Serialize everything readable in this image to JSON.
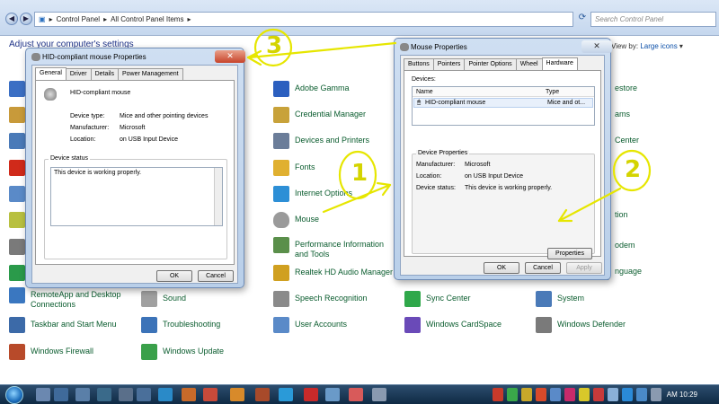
{
  "explorer": {
    "breadcrumb": [
      "Control Panel",
      "All Control Panel Items"
    ],
    "search_placeholder": "Search Control Panel",
    "header": "Adjust your computer's settings",
    "view_by_label": "View by:",
    "view_by_value": "Large icons"
  },
  "cp_items": [
    {
      "label": "Adobe Gamma",
      "color": "#2b5fbf"
    },
    {
      "label": "Credential Manager",
      "color": "#c8a23a"
    },
    {
      "label": "Devices and Printers",
      "color": "#6b7d99"
    },
    {
      "label": "Fonts",
      "color": "#e0b030"
    },
    {
      "label": "Internet Options",
      "color": "#2d8fd6"
    },
    {
      "label": "Mouse",
      "color": "#9a9a9a"
    },
    {
      "label": "Performance Information and Tools",
      "color": "#5a8f4a"
    },
    {
      "label": "Realtek HD Audio Manager",
      "color": "#d0a020"
    },
    {
      "label": "RemoteApp and Desktop Connections",
      "color": "#3a77c0"
    },
    {
      "label": "Sound",
      "color": "#a0a0a0"
    },
    {
      "label": "Speech Recognition",
      "color": "#8a8a8a"
    },
    {
      "label": "Sync Center",
      "color": "#2fa84a"
    },
    {
      "label": "System",
      "color": "#4a7ab8"
    },
    {
      "label": "Taskbar and Start Menu",
      "color": "#3c6aa8"
    },
    {
      "label": "Troubleshooting",
      "color": "#3c73b8"
    },
    {
      "label": "User Accounts",
      "color": "#5a8ac8"
    },
    {
      "label": "Windows CardSpace",
      "color": "#6a4ab8"
    },
    {
      "label": "Windows Defender",
      "color": "#7a7a7a"
    },
    {
      "label": "Windows Firewall",
      "color": "#b84a2a"
    },
    {
      "label": "Windows Update",
      "color": "#3aa04a"
    },
    {
      "label": "estore",
      "color": "#3a6ab0"
    },
    {
      "label": "ams",
      "color": "#4a8ab0"
    },
    {
      "label": "Center",
      "color": "#2a8a5a"
    },
    {
      "label": "tion",
      "color": "#6a6a6a"
    },
    {
      "label": "odem",
      "color": "#6a6a6a"
    },
    {
      "label": "nguage",
      "color": "#3a7ab0"
    }
  ],
  "hid_dialog": {
    "title": "HID-compliant mouse Properties",
    "tabs": [
      "General",
      "Driver",
      "Details",
      "Power Management"
    ],
    "device_name": "HID-compliant mouse",
    "fields": [
      {
        "key": "Device type:",
        "value": "Mice and other pointing devices"
      },
      {
        "key": "Manufacturer:",
        "value": "Microsoft"
      },
      {
        "key": "Location:",
        "value": "on USB Input Device"
      }
    ],
    "status_group": "Device status",
    "status_text": "This device is working properly.",
    "ok": "OK",
    "cancel": "Cancel",
    "close": "✕"
  },
  "mouse_dialog": {
    "title": "Mouse Properties",
    "tabs": [
      "Buttons",
      "Pointers",
      "Pointer Options",
      "Wheel",
      "Hardware"
    ],
    "devices_label": "Devices:",
    "columns": [
      "Name",
      "Type"
    ],
    "rows": [
      {
        "name": "HID-compliant mouse",
        "type": "Mice and ot..."
      }
    ],
    "props_group": "Device Properties",
    "fields": [
      {
        "key": "Manufacturer:",
        "value": "Microsoft"
      },
      {
        "key": "Location:",
        "value": "on USB Input Device"
      },
      {
        "key": "Device status:",
        "value": "This device is working properly."
      }
    ],
    "properties_btn": "Properties",
    "ok": "OK",
    "cancel": "Cancel",
    "apply": "Apply",
    "close": "✕"
  },
  "annotations": [
    "1",
    "2",
    "3"
  ],
  "taskbar": {
    "clock": "AM 10:29"
  }
}
